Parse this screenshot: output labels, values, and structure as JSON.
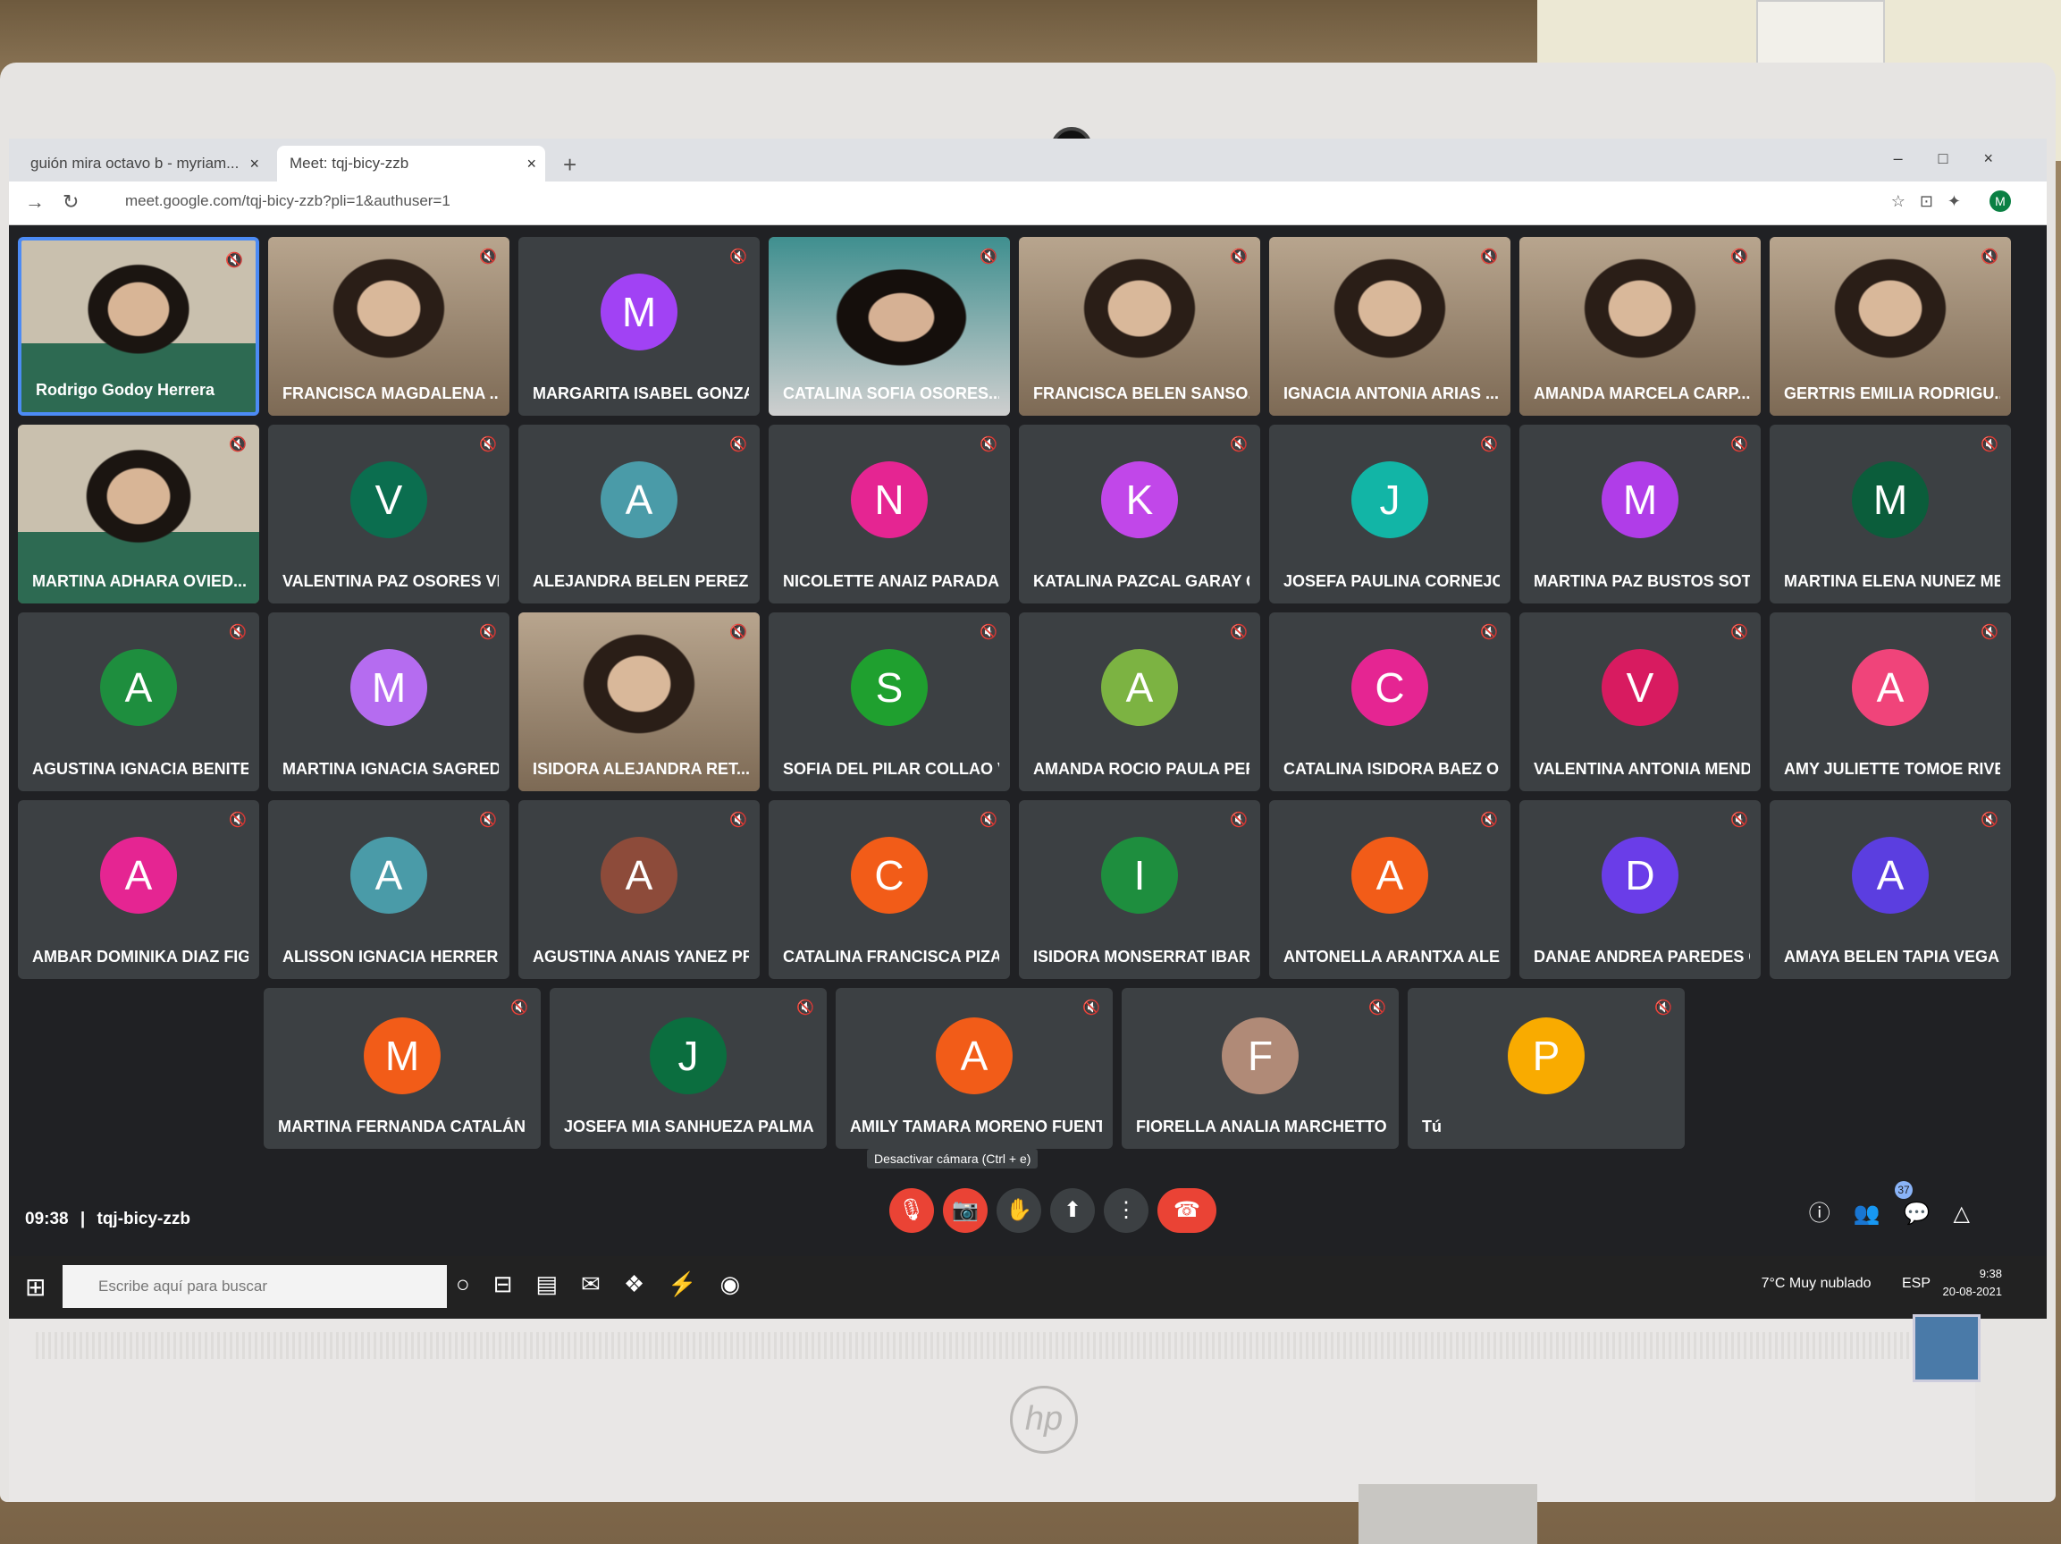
{
  "browser": {
    "tabs": [
      {
        "label": "guión mira octavo b - myriam...",
        "active": false
      },
      {
        "label": "Meet: tqj-bicy-zzb",
        "active": true
      }
    ],
    "url": "meet.google.com/tqj-bicy-zzb?pli=1&authuser=1",
    "profile_initial": "M"
  },
  "participants": [
    {
      "name": "Rodrigo Godoy Herrera",
      "video": true,
      "style": "green",
      "speaking": true
    },
    {
      "name": "FRANCISCA MAGDALENA ...",
      "video": true,
      "style": "default"
    },
    {
      "name": "MARGARITA ISABEL GONZA...",
      "initial": "M",
      "color": "#a142f4"
    },
    {
      "name": "CATALINA SOFIA OSORES...",
      "video": true,
      "style": "teal"
    },
    {
      "name": "FRANCISCA BELEN SANSO...",
      "video": true,
      "style": "default"
    },
    {
      "name": "IGNACIA ANTONIA ARIAS ...",
      "video": true,
      "style": "default"
    },
    {
      "name": "AMANDA MARCELA CARP...",
      "video": true,
      "style": "default"
    },
    {
      "name": "GERTRIS EMILIA RODRIGU...",
      "video": true,
      "style": "default"
    },
    {
      "name": "MARTINA ADHARA OVIED...",
      "video": true,
      "style": "green"
    },
    {
      "name": "VALENTINA PAZ OSORES VI...",
      "initial": "V",
      "color": "#0b6e4f"
    },
    {
      "name": "ALEJANDRA BELEN PEREZ E...",
      "initial": "A",
      "color": "#4a9ba8"
    },
    {
      "name": "NICOLETTE ANAIZ PARADA ...",
      "initial": "N",
      "color": "#e52592"
    },
    {
      "name": "KATALINA PAZCAL GARAY Q...",
      "initial": "K",
      "color": "#c147e9"
    },
    {
      "name": "JOSEFA PAULINA CORNEJO...",
      "initial": "J",
      "color": "#12b5a6"
    },
    {
      "name": "MARTINA PAZ BUSTOS SOTO",
      "initial": "M",
      "color": "#b03de8"
    },
    {
      "name": "MARTINA ELENA NUNEZ ME...",
      "initial": "M",
      "color": "#0b5d3b"
    },
    {
      "name": "AGUSTINA IGNACIA BENITE...",
      "initial": "A",
      "color": "#1e8e3e"
    },
    {
      "name": "MARTINA IGNACIA SAGRED...",
      "initial": "M",
      "color": "#b56cf0"
    },
    {
      "name": "ISIDORA ALEJANDRA RET...",
      "video": true,
      "style": "default"
    },
    {
      "name": "SOFIA DEL PILAR COLLAO V...",
      "initial": "S",
      "color": "#1fa02f"
    },
    {
      "name": "AMANDA ROCIO PAULA PER...",
      "initial": "A",
      "color": "#7cb342"
    },
    {
      "name": "CATALINA ISIDORA BAEZ O...",
      "initial": "C",
      "color": "#e52592"
    },
    {
      "name": "VALENTINA ANTONIA MEND...",
      "initial": "V",
      "color": "#d81b60"
    },
    {
      "name": "AMY JULIETTE TOMOE RIVE...",
      "initial": "A",
      "color": "#f0447a"
    },
    {
      "name": "AMBAR DOMINIKA DIAZ FIG...",
      "initial": "A",
      "color": "#e52592"
    },
    {
      "name": "ALISSON IGNACIA HERRER...",
      "initial": "A",
      "color": "#4a9ba8"
    },
    {
      "name": "AGUSTINA ANAIS YANEZ PR...",
      "initial": "A",
      "color": "#8d4b3a"
    },
    {
      "name": "CATALINA FRANCISCA PIZA...",
      "initial": "C",
      "color": "#f25c18"
    },
    {
      "name": "ISIDORA MONSERRAT IBAR...",
      "initial": "I",
      "color": "#1e8e3e"
    },
    {
      "name": "ANTONELLA ARANTXA ALE...",
      "initial": "A",
      "color": "#f25c18"
    },
    {
      "name": "DANAE ANDREA PAREDES C...",
      "initial": "D",
      "color": "#6a3de8"
    },
    {
      "name": "AMAYA BELEN TAPIA VEGA",
      "initial": "A",
      "color": "#5b3ee0"
    },
    {
      "name": "MARTINA FERNANDA CATALÁN COÑU...",
      "initial": "M",
      "color": "#f25c18"
    },
    {
      "name": "JOSEFA MIA SANHUEZA PALMA",
      "initial": "J",
      "color": "#0b6e3f"
    },
    {
      "name": "AMILY TAMARA MORENO FUENTES",
      "initial": "A",
      "color": "#f25c18"
    },
    {
      "name": "FIORELLA ANALIA MARCHETTO AREV...",
      "initial": "F",
      "color": "#b08a77"
    },
    {
      "name": "Tú",
      "initial": "P",
      "color": "#f9ab00"
    }
  ],
  "bottom_bar": {
    "time": "09:38",
    "separator": "|",
    "meeting_code": "tqj-bicy-zzb",
    "tooltip": "Desactivar cámara (Ctrl + e)",
    "controls": [
      "mic-off",
      "camera-off",
      "raise-hand",
      "present",
      "more",
      "hang-up"
    ],
    "people_count": "37"
  },
  "taskbar": {
    "search_placeholder": "Escribe aquí para buscar",
    "weather": "7°C  Muy nublado",
    "lang": "ESP",
    "clock_time": "9:38",
    "clock_date": "20-08-2021"
  },
  "icons": {
    "mute": "🔇",
    "mic_off": "🎙",
    "camera_off": "📷",
    "hand": "✋",
    "present": "⬆",
    "more": "⋮",
    "hangup": "☎",
    "info": "ⓘ",
    "people": "👥",
    "chat": "💬",
    "activities": "△",
    "windows": "⊞"
  }
}
